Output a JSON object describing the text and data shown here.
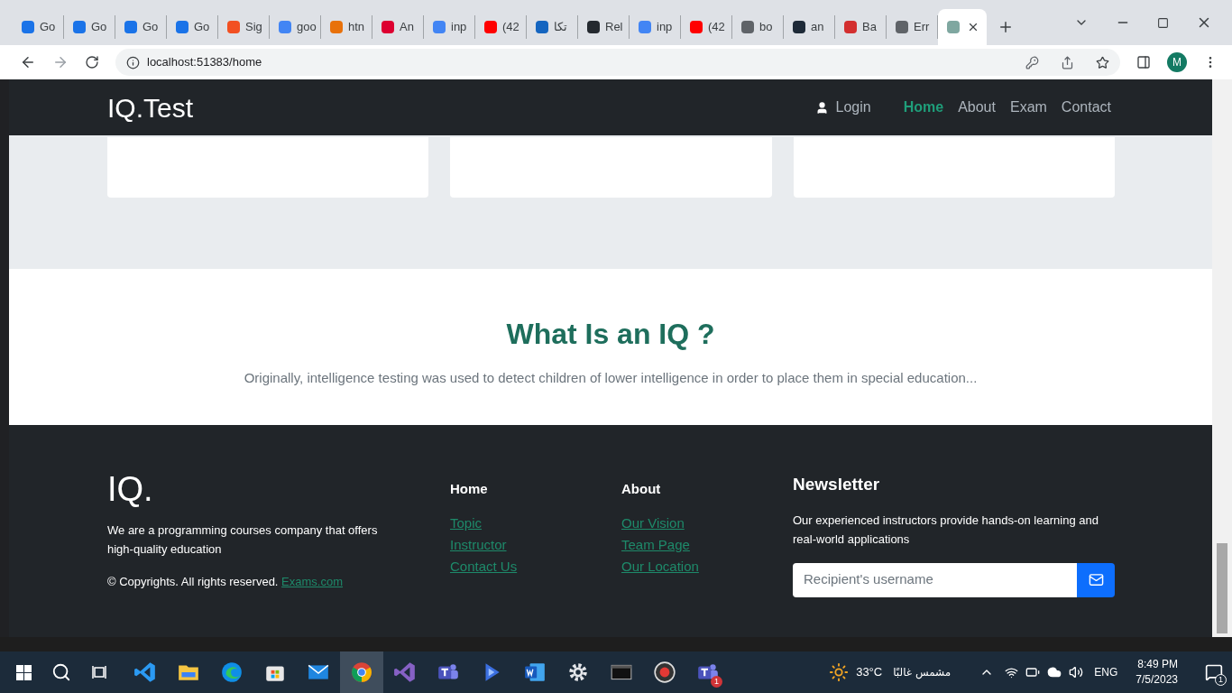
{
  "browser": {
    "tabs": [
      {
        "title": "Go",
        "color": "#1a73e8",
        "selected": false
      },
      {
        "title": "Go",
        "color": "#1a73e8",
        "selected": false
      },
      {
        "title": "Go",
        "color": "#1a73e8",
        "selected": false
      },
      {
        "title": "Go",
        "color": "#1a73e8",
        "selected": false
      },
      {
        "title": "Sig",
        "color": "#f25022",
        "selected": false
      },
      {
        "title": "goo",
        "color": "#4285f4",
        "selected": false
      },
      {
        "title": "htn",
        "color": "#e8710a",
        "selected": false
      },
      {
        "title": "An",
        "color": "#dd0031",
        "selected": false
      },
      {
        "title": "inp",
        "color": "#4285f4",
        "selected": false
      },
      {
        "title": "(42",
        "color": "#ff0000",
        "selected": false
      },
      {
        "title": "تكا",
        "color": "#1565c0",
        "selected": false
      },
      {
        "title": "Rel",
        "color": "#24292f",
        "selected": false
      },
      {
        "title": "inp",
        "color": "#4285f4",
        "selected": false
      },
      {
        "title": "(42",
        "color": "#ff0000",
        "selected": false
      },
      {
        "title": "bo",
        "color": "#5f6368",
        "selected": false
      },
      {
        "title": "an",
        "color": "#1e2a38",
        "selected": false
      },
      {
        "title": "Ba",
        "color": "#d32f2f",
        "selected": false
      },
      {
        "title": "Err",
        "color": "#5f6368",
        "selected": false
      },
      {
        "color": "#7fa7a0",
        "selected": true
      }
    ],
    "address": "localhost:51383/home",
    "profile": "M"
  },
  "navbar": {
    "brand": "IQ.Test",
    "login": "Login",
    "links": [
      {
        "label": "Home",
        "selected": true
      },
      {
        "label": "About",
        "selected": false
      },
      {
        "label": "Exam",
        "selected": false
      },
      {
        "label": "Contact",
        "selected": false
      }
    ]
  },
  "about": {
    "title": "What Is an IQ ?",
    "text": "Originally, intelligence testing was used to detect children of lower intelligence in order to place them in special education..."
  },
  "footer": {
    "brand": "IQ.",
    "description": "We are a programming courses company that offers high-quality education",
    "copyright": "© Copyrights. All rights reserved.",
    "copyright_link": "Exams.com",
    "columns": [
      {
        "heading": "Home",
        "links": [
          "Topic",
          "Instructor",
          "Contact Us"
        ]
      },
      {
        "heading": "About",
        "links": [
          "Our Vision",
          "Team Page",
          "Our Location"
        ]
      }
    ],
    "newsletter": {
      "title": "Newsletter",
      "text": "Our experienced instructors provide hands-on learning and real-world applications",
      "placeholder": "Recipient's username"
    }
  },
  "taskbar": {
    "apps": [
      {
        "kind": "vscode",
        "selected": false
      },
      {
        "kind": "folder",
        "selected": false
      },
      {
        "kind": "edge",
        "selected": false
      },
      {
        "kind": "store",
        "selected": false
      },
      {
        "kind": "mail",
        "selected": false
      },
      {
        "kind": "chrome",
        "selected": true
      },
      {
        "kind": "vs",
        "selected": false
      },
      {
        "kind": "teams",
        "selected": false
      },
      {
        "kind": "azure",
        "selected": false
      },
      {
        "kind": "word",
        "selected": false
      },
      {
        "kind": "gear",
        "selected": false
      },
      {
        "kind": "terminal",
        "selected": false
      },
      {
        "kind": "record",
        "selected": false
      },
      {
        "kind": "teams",
        "selected": false,
        "badge": "1"
      }
    ],
    "temperature": "33°C",
    "weather": "مشمس غالبًا",
    "language": "ENG",
    "time": "8:49 PM",
    "date": "7/5/2023",
    "notifications": "1"
  }
}
